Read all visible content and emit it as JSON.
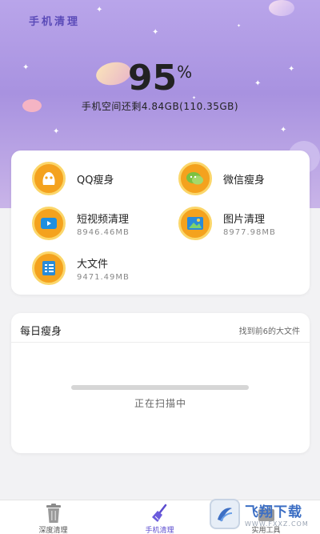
{
  "app": {
    "title": "手机清理"
  },
  "storage": {
    "percent": "95",
    "percent_sign": "%",
    "summary": "手机空间还剩4.84GB(110.35GB)"
  },
  "tools": [
    {
      "name": "QQ瘦身",
      "size": "",
      "icon": "qq-icon"
    },
    {
      "name": "微信瘦身",
      "size": "",
      "icon": "wechat-icon"
    },
    {
      "name": "短视频清理",
      "size": "8946.46MB",
      "icon": "video-icon"
    },
    {
      "name": "图片清理",
      "size": "8977.98MB",
      "icon": "image-icon"
    },
    {
      "name": "大文件",
      "size": "9471.49MB",
      "icon": "file-list-icon"
    }
  ],
  "daily": {
    "title": "每日瘦身",
    "subtitle": "找到前6的大文件",
    "status": "正在扫描中",
    "progress": 0
  },
  "bottom_nav": [
    {
      "label": "深度清理",
      "icon": "trash-can-icon",
      "active": false
    },
    {
      "label": "手机清理",
      "icon": "broom-icon",
      "active": true
    },
    {
      "label": "实用工具",
      "icon": "toolbox-icon",
      "active": false
    }
  ],
  "watermark": {
    "title": "飞翔下载",
    "url": "WWW.FXXZ.COM"
  },
  "colors": {
    "accent": "#5b4ccf",
    "icon_orange": "#f4a21e",
    "hero_purple": "#b9a5ea"
  }
}
